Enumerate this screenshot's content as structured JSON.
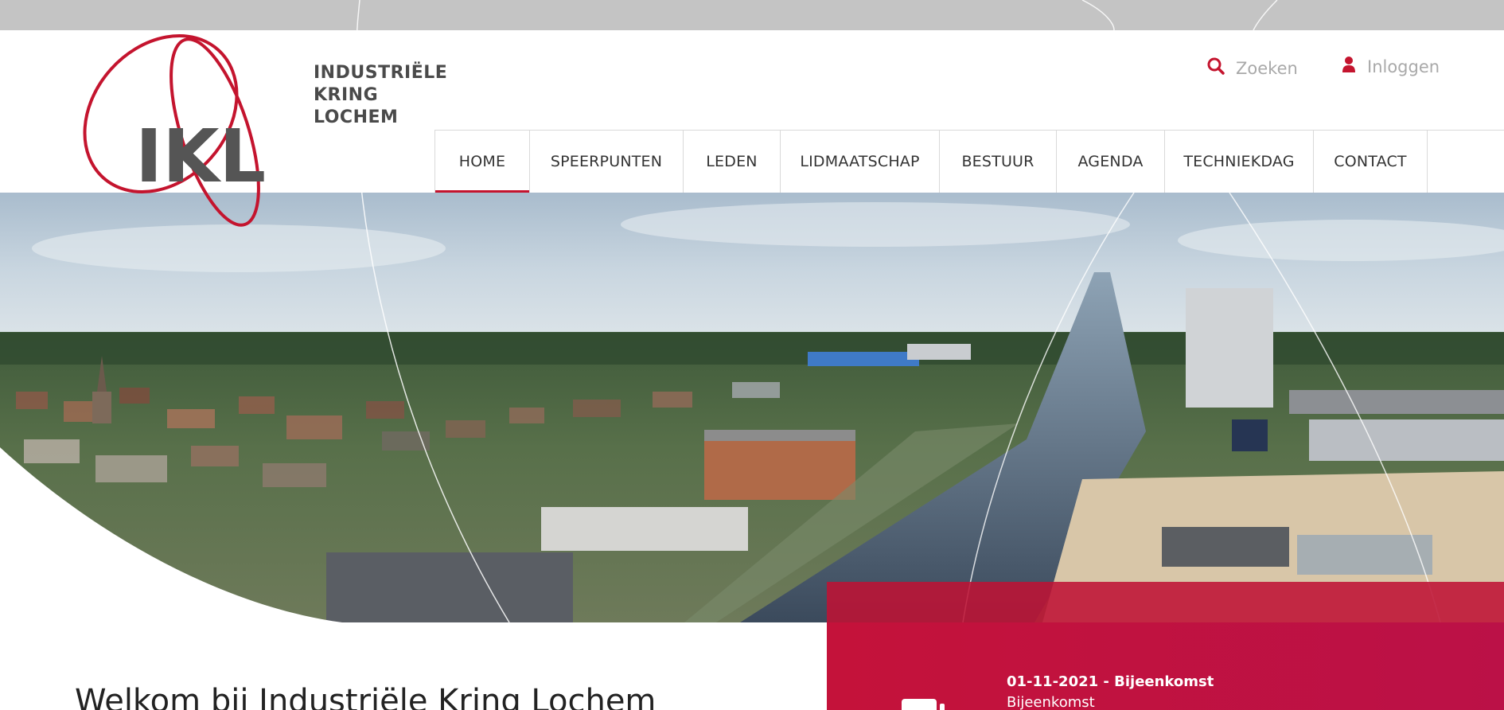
{
  "logo": {
    "monogram": "IKL",
    "line1": "INDUSTRIËLE",
    "line2": "KRING",
    "line3": "LOCHEM"
  },
  "utility": {
    "search_label": "Zoeken",
    "login_label": "Inloggen"
  },
  "nav": {
    "items": [
      {
        "label": "HOME"
      },
      {
        "label": "SPEERPUNTEN"
      },
      {
        "label": "LEDEN"
      },
      {
        "label": "LIDMAATSCHAP"
      },
      {
        "label": "BESTUUR"
      },
      {
        "label": "AGENDA"
      },
      {
        "label": "TECHNIEKDAG"
      },
      {
        "label": "CONTACT"
      }
    ],
    "active": "HOME"
  },
  "main": {
    "welcome_title": "Welkom bij Industriële Kring Lochem"
  },
  "agenda": {
    "event_title": "01-11-2021 - Bijeenkomst",
    "event_subtitle": "Bijeenkomst"
  },
  "colors": {
    "brand_red": "#c4142e",
    "nav_border": "#d9d9d9",
    "top_strip": "#c4c4c4",
    "text_grey": "#a9a9a9"
  },
  "icons": {
    "search": "search-icon",
    "login": "user-icon",
    "calendar": "calendar-icon"
  }
}
